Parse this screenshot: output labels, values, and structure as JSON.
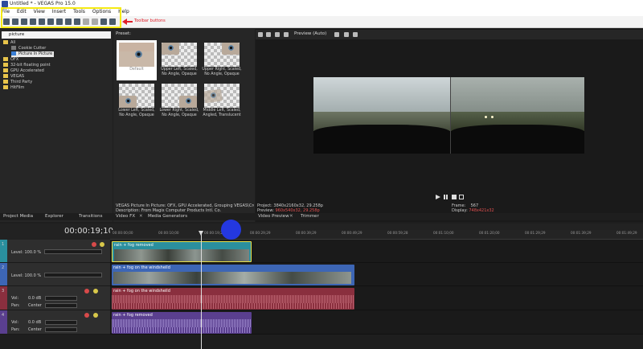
{
  "window": {
    "title": "Untitled * - VEGAS Pro 15.0"
  },
  "menu": [
    "File",
    "Edit",
    "View",
    "Insert",
    "Tools",
    "Options",
    "Help"
  ],
  "annotation": {
    "label": "Toolbar buttons",
    "highlight_color": "#f5ea13",
    "arrow_color": "#e0202a"
  },
  "fx_browser": {
    "search_value": "picture",
    "tree": [
      {
        "label": "All",
        "icon": "folder-icon"
      },
      {
        "label": "Cookie Cutter",
        "icon": "fx-icon"
      },
      {
        "label": "Picture In Picture",
        "icon": "fx-icon",
        "selected": true
      },
      {
        "label": "OFX",
        "icon": "folder-icon"
      },
      {
        "label": "32-bit floating point",
        "icon": "folder-icon"
      },
      {
        "label": "GPU Accelerated",
        "icon": "folder-icon"
      },
      {
        "label": "VEGAS",
        "icon": "folder-icon"
      },
      {
        "label": "Third Party",
        "icon": "folder-icon"
      },
      {
        "label": "HitFilm",
        "icon": "folder-icon"
      }
    ],
    "tabs": [
      "Project Media",
      "Explorer",
      "Transitions"
    ]
  },
  "presets": {
    "header": "Preset:",
    "items": [
      {
        "label": "Default"
      },
      {
        "label": "Upper Left, Scaled, No Angle, Opaque"
      },
      {
        "label": "Upper Right, Scaled, No Angle, Opaque"
      },
      {
        "label": "Lower Left, Scaled, No Angle, Opaque"
      },
      {
        "label": "Lower Right, Scaled, No Angle, Opaque"
      },
      {
        "label": "Middle Left, Scaled, Angled, Translucent"
      }
    ],
    "description_line1": "VEGAS Picture In Picture: OFX, GPU Accelerated, Grouping VEGAS\\Creative, Ve",
    "description_line2": "Description: From Magix Computer Products Intl. Co.",
    "tabs": [
      "Video FX",
      "Media Generators"
    ]
  },
  "preview": {
    "quality": "Preview (Auto)",
    "project_label": "Project:",
    "project_value": "3840x2160x32, 29.258p",
    "preview_label": "Preview:",
    "preview_value": "960x540x32, 29.258p",
    "frame_label": "Frame:",
    "frame_value": "567",
    "display_label": "Display:",
    "display_value": "748x421x32",
    "tabs": [
      "Video Preview",
      "Trimmer"
    ]
  },
  "timeline": {
    "timecode": "00:00:19;10",
    "ruler": [
      "00:00:00;00",
      "00:00:10;00",
      "00:00:19;29",
      "00:00:29;29",
      "00:00:39;29",
      "00:00:49;29",
      "00:00:59;28",
      "00:01:10;00",
      "00:01:20;00",
      "00:01:29;29",
      "00:01:39;29",
      "00:01:49;29"
    ],
    "tracks": [
      {
        "type": "video",
        "number": "1",
        "level_label": "Level: 100.0 %",
        "clip": "rain + fog removed",
        "color": "#2a8f9e"
      },
      {
        "type": "video",
        "number": "2",
        "level_label": "Level: 100.0 %",
        "clip": "rain + fog on the windsheild",
        "color": "#3d66b5"
      },
      {
        "type": "audio",
        "number": "3",
        "vol_label": "Vol:",
        "vol_value": "0.0 dB",
        "pan_label": "Pan:",
        "pan_value": "Center",
        "clip": "rain + fog on the windsheild",
        "color": "#8a2f3e"
      },
      {
        "type": "audio",
        "number": "4",
        "vol_label": "Vol:",
        "vol_value": "0.0 dB",
        "pan_label": "Pan:",
        "pan_value": "Center",
        "clip": "rain + fog removed",
        "color": "#5a3f8f"
      }
    ]
  }
}
